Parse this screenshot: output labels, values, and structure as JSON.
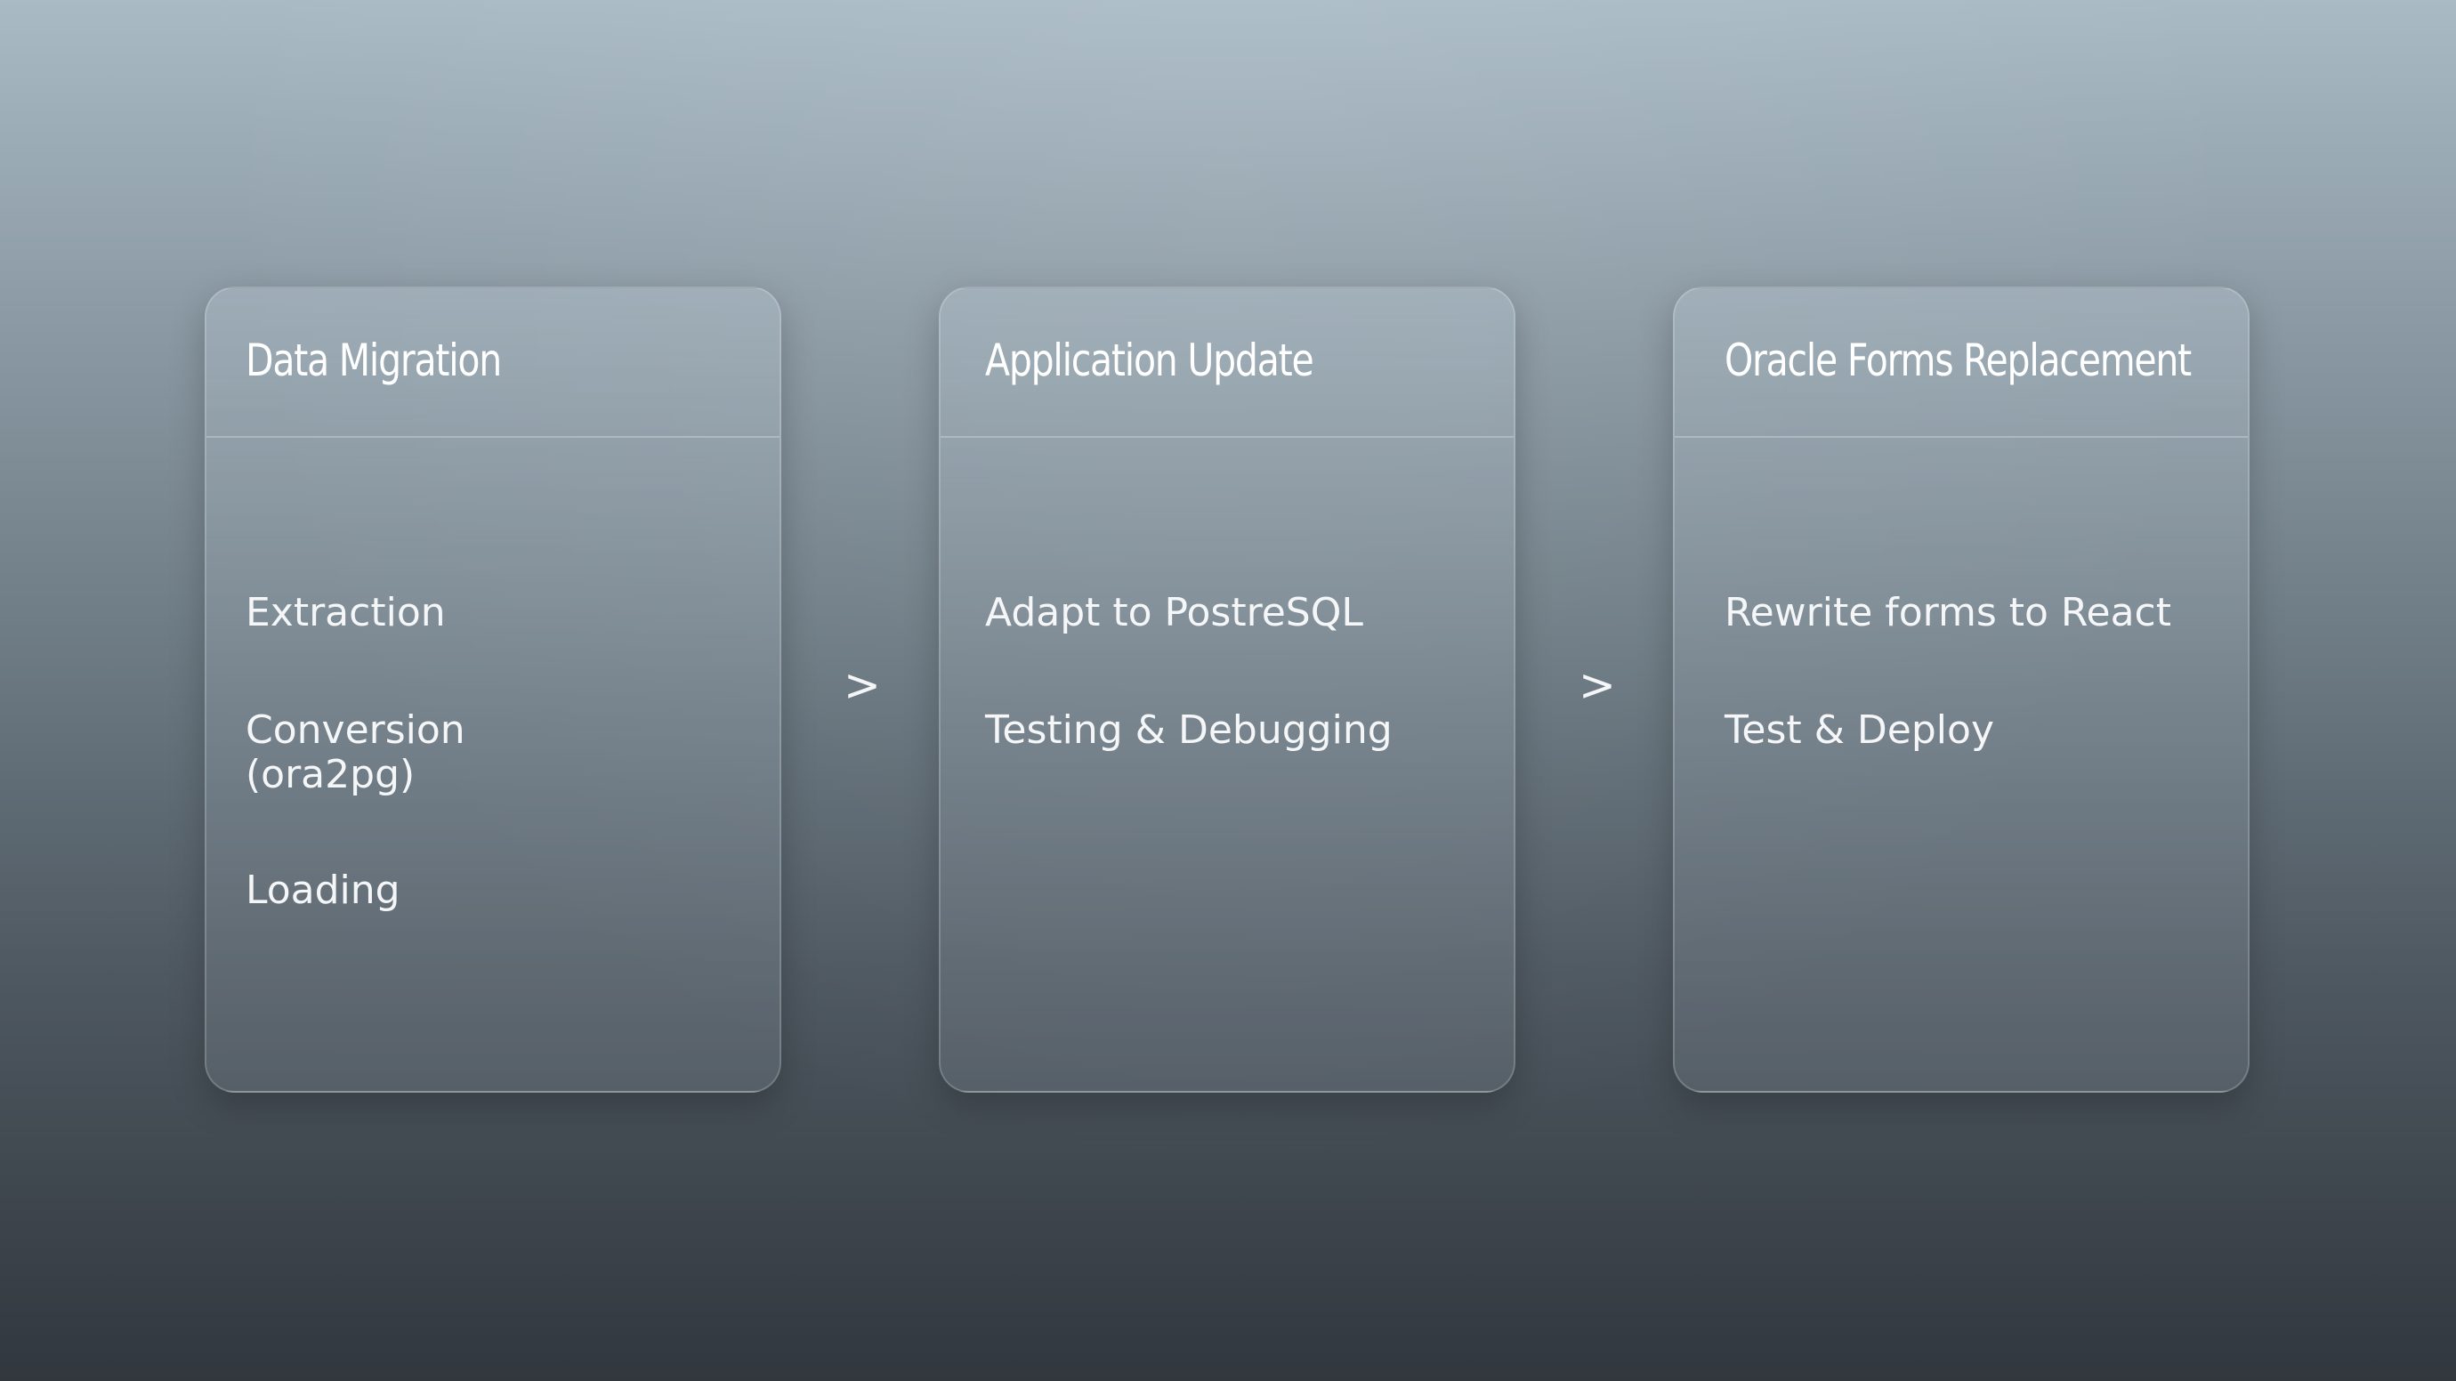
{
  "stages": [
    {
      "title": "Data Migration",
      "items": [
        "Extraction",
        "Conversion",
        "(ora2pg)",
        "Loading"
      ]
    },
    {
      "title": "Application Update",
      "items": [
        "Adapt to PostreSQL",
        "Testing & Debugging"
      ]
    },
    {
      "title": "Oracle Forms Replacement",
      "items": [
        "Rewrite forms to React",
        "Test & Deploy"
      ]
    }
  ],
  "connectors": [
    ">",
    ">"
  ]
}
